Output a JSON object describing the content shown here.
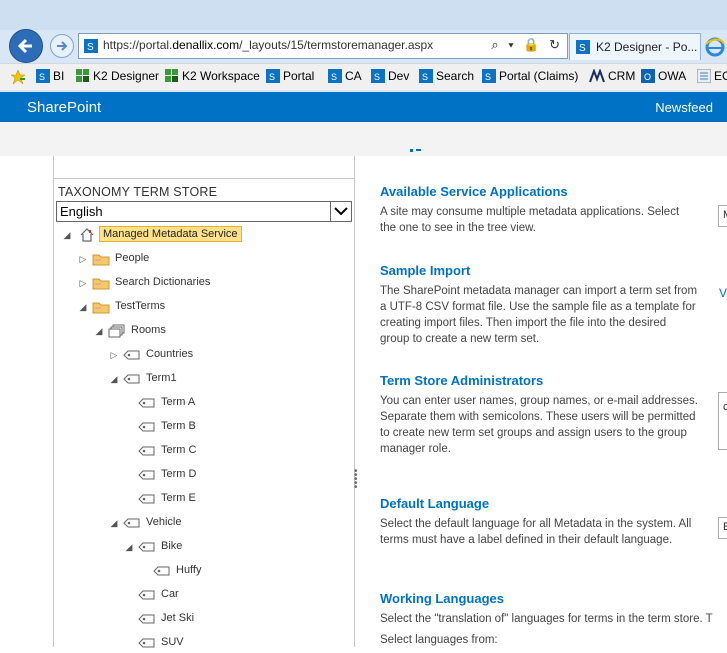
{
  "browser": {
    "url_prefix": "https://portal.",
    "url_domain": "denallix.com",
    "url_path": "/_layouts/15/termstoremanager.aspx",
    "address_controls": "⌕ ▾ 🔒 ↻",
    "tab_title": "K2 Designer - Po..."
  },
  "favorites": [
    {
      "label": "BI"
    },
    {
      "label": "K2 Designer"
    },
    {
      "label": "K2 Workspace"
    },
    {
      "label": "Portal"
    },
    {
      "label": "CA"
    },
    {
      "label": "Dev"
    },
    {
      "label": "Search"
    },
    {
      "label": "Portal (Claims)"
    },
    {
      "label": "CRM"
    },
    {
      "label": "OWA"
    },
    {
      "label": "EC"
    }
  ],
  "suite": {
    "title": "SharePoint",
    "newsfeed": "Newsfeed"
  },
  "tree": {
    "header": "TAXONOMY TERM STORE",
    "language": "English",
    "nodes": [
      {
        "label": "Managed Metadata Service"
      },
      {
        "label": "People"
      },
      {
        "label": "Search Dictionaries"
      },
      {
        "label": "TestTerms"
      },
      {
        "label": "Rooms"
      },
      {
        "label": "Countries"
      },
      {
        "label": "Term1"
      },
      {
        "label": "Term A"
      },
      {
        "label": "Term B"
      },
      {
        "label": "Term C"
      },
      {
        "label": "Term D"
      },
      {
        "label": "Term E"
      },
      {
        "label": "Vehicle"
      },
      {
        "label": "Bike"
      },
      {
        "label": "Huffy"
      },
      {
        "label": "Car"
      },
      {
        "label": "Jet Ski"
      },
      {
        "label": "SUV"
      }
    ]
  },
  "sections": [
    {
      "heading": "Available Service Applications",
      "text": "A site may consume multiple metadata applications. Select the one to see in the tree view."
    },
    {
      "heading": "Sample Import",
      "text": "The SharePoint metadata manager can import a term set from a UTF-8 CSV format file. Use the sample file as a template for creating import files. Then import the file into the desired group to create a new term set."
    },
    {
      "heading": "Term Store Administrators",
      "text": "You can enter user names, group names, or e-mail addresses. Separate them with semicolons. These users will be permitted to create new term set groups and assign users to the group manager role."
    },
    {
      "heading": "Default Language",
      "text": "Select the default language for all Metadata in the system. All terms must have a label defined in their default language."
    },
    {
      "heading": "Working Languages",
      "text": "Select the \"translation of\" languages for terms in the term store. T"
    },
    {
      "heading": "",
      "text": "Select languages from:"
    }
  ],
  "edge": {
    "service_box": "M",
    "sample_link": "V",
    "admins_box": "c",
    "default_box": "E"
  }
}
